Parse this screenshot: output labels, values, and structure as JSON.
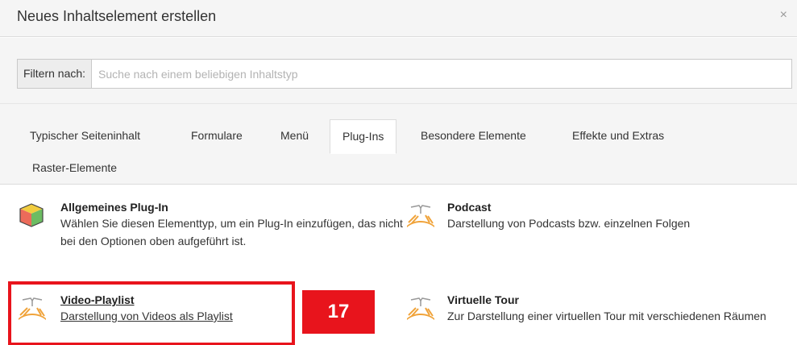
{
  "dialog": {
    "title": "Neues Inhaltselement erstellen",
    "close_glyph": "×"
  },
  "filter": {
    "label": "Filtern nach:",
    "placeholder": "Suche nach einem beliebigen Inhaltstyp",
    "value": ""
  },
  "tabs": [
    {
      "label": "Typischer Seiteninhalt",
      "active": false
    },
    {
      "label": "Formulare",
      "active": false
    },
    {
      "label": "Menü",
      "active": false
    },
    {
      "label": "Plug-Ins",
      "active": true
    },
    {
      "label": "Besondere Elemente",
      "active": false
    },
    {
      "label": "Effekte und Extras",
      "active": false
    },
    {
      "label": "Raster-Elemente",
      "active": false
    }
  ],
  "items": [
    {
      "title": "Allgemeines Plug-In",
      "description": "Wählen Sie diesen Elementtyp, um ein Plug-In einzufügen, das nicht bei den Optionen oben aufgeführt ist.",
      "icon": "cube-plugin-icon"
    },
    {
      "title": "Podcast",
      "description": "Darstellung von Podcasts bzw. einzelnen Folgen",
      "icon": "extension-book-icon"
    },
    {
      "title": "Video-Playlist",
      "description": "Darstellung von Videos als Playlist",
      "icon": "extension-book-icon"
    },
    {
      "title": "Virtuelle Tour",
      "description": "Zur Darstellung einer virtuellen Tour mit verschiedenen Räumen",
      "icon": "extension-book-icon"
    }
  ],
  "annotation": {
    "badge_text": "17",
    "color": "#e8141c"
  }
}
